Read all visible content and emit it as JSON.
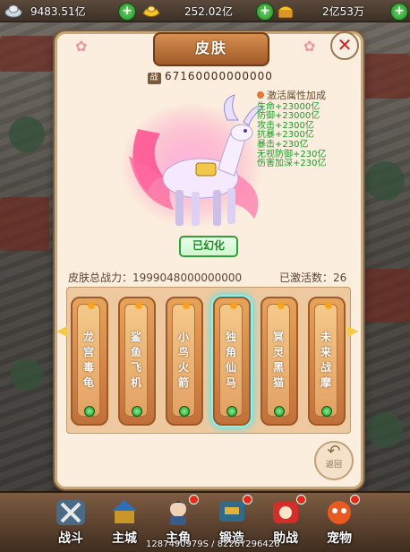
{
  "resources": [
    {
      "icon": "silver-icon",
      "value": "9483.51亿"
    },
    {
      "icon": "gold-ingot-icon",
      "value": "252.02亿"
    },
    {
      "icon": "treasure-icon",
      "value": "2亿53万"
    }
  ],
  "panel": {
    "title": "皮肤",
    "power_label": "战",
    "power_value": "67160000000000",
    "attributes_heading": "激活属性加成",
    "attributes": [
      "生命+23000亿",
      "防御+23000亿",
      "攻击+2300亿",
      "抗暴+2300亿",
      "暴击+230亿",
      "无视防御+230亿",
      "伤害加深+230亿"
    ],
    "status_badge": "已幻化",
    "total_power": "皮肤总战力：1999048000000000",
    "activated_count": "已激活数：26",
    "skins": [
      {
        "name": "龙宫毒龟",
        "selected": false
      },
      {
        "name": "鲨鱼飞机",
        "selected": false
      },
      {
        "name": "小鸟火箭",
        "selected": false
      },
      {
        "name": "独角仙马",
        "selected": true
      },
      {
        "name": "冥灵黑猫",
        "selected": false
      },
      {
        "name": "未来战摩",
        "selected": false
      }
    ],
    "back_label": "返回"
  },
  "nav": [
    {
      "label": "战斗",
      "icon": "crossed-swords-icon"
    },
    {
      "label": "主城",
      "icon": "city-icon"
    },
    {
      "label": "主角",
      "icon": "hero-portrait-icon"
    },
    {
      "label": "锻造",
      "icon": "anvil-icon"
    },
    {
      "label": "助战",
      "icon": "assist-icon"
    },
    {
      "label": "宠物",
      "icon": "pet-icon"
    }
  ],
  "footer_text": "1287490979S / 8226Y296426"
}
